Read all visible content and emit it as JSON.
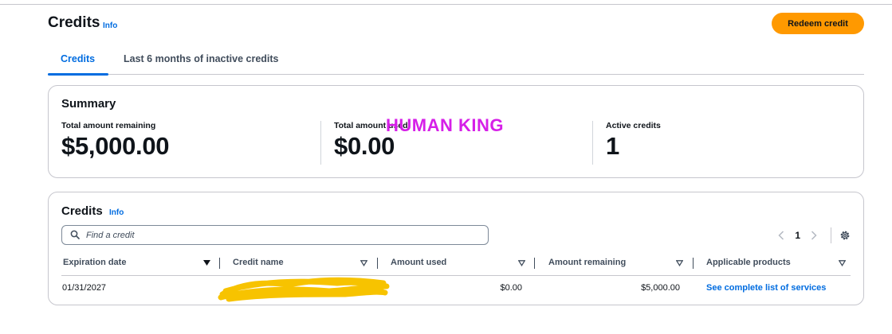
{
  "header": {
    "title": "Credits",
    "info_label": "Info",
    "redeem_button_label": "Redeem credit"
  },
  "tabs": [
    {
      "label": "Credits",
      "active": true
    },
    {
      "label": "Last 6 months of inactive credits",
      "active": false
    }
  ],
  "summary": {
    "title": "Summary",
    "metrics": [
      {
        "label": "Total amount remaining",
        "value": "$5,000.00"
      },
      {
        "label": "Total amount used",
        "value": "$0.00"
      },
      {
        "label": "Active credits",
        "value": "1"
      }
    ],
    "overlay_text": "HUMAN KING"
  },
  "credits_table": {
    "title": "Credits",
    "info_label": "Info",
    "search_placeholder": "Find a credit",
    "current_page": "1",
    "columns": [
      "Expiration date",
      "Credit name",
      "Amount used",
      "Amount remaining",
      "Applicable products"
    ],
    "rows": [
      {
        "expiration_date": "01/31/2027",
        "credit_name": "",
        "amount_used": "$0.00",
        "amount_remaining": "$5,000.00",
        "applicable_products": "See complete list of services"
      }
    ]
  },
  "colors": {
    "accent_blue": "#006ce0",
    "primary_orange": "#ff9900",
    "overlay_magenta": "#d61fe8",
    "redaction_yellow": "#f7c300"
  }
}
